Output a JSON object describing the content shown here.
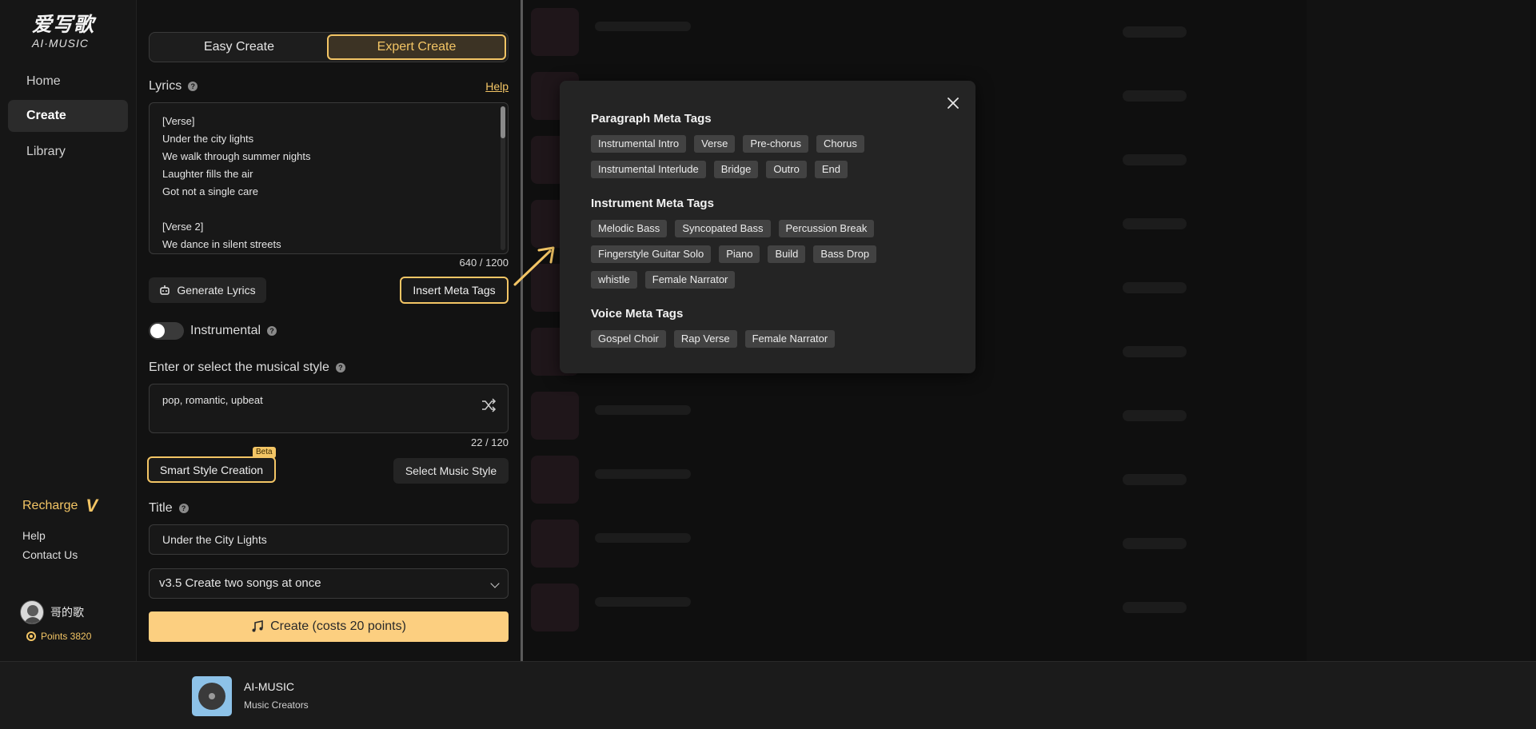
{
  "sidebar": {
    "logo_cn": "爱写歌",
    "logo_en": "AI·MUSIC",
    "items": [
      {
        "label": "Home"
      },
      {
        "label": "Create"
      },
      {
        "label": "Library"
      }
    ],
    "recharge": "Recharge",
    "recharge_badge": "V",
    "help": "Help",
    "contact": "Contact Us",
    "username": "哥的歌",
    "points": "Points 3820"
  },
  "create": {
    "modes": [
      "Easy Create",
      "Expert Create"
    ],
    "lyrics_label": "Lyrics",
    "help_link": "Help",
    "lyrics_lines": [
      "[Verse]",
      "Under the city lights",
      "We walk through summer nights",
      "Laughter fills the air",
      "Got not a single care",
      "",
      "[Verse 2]",
      "We dance in silent streets"
    ],
    "lyrics_counter": "640 / 1200",
    "generate_lyrics": "Generate Lyrics",
    "insert_meta_tags": "Insert Meta Tags",
    "instrumental_label": "Instrumental",
    "style_label": "Enter or select the musical style",
    "style_value": "pop, romantic, upbeat",
    "style_counter": "22 / 120",
    "smart_style": "Smart Style Creation",
    "beta": "Beta",
    "select_style": "Select Music Style",
    "title_label": "Title",
    "title_value": "Under the City Lights",
    "version_select": "v3.5 Create two songs at once",
    "create_button": "Create (costs 20 points)"
  },
  "meta_popup": {
    "paragraph_title": "Paragraph Meta Tags",
    "paragraph_rows": [
      [
        "Instrumental Intro",
        "Verse",
        "Pre-chorus",
        "Chorus"
      ],
      [
        "Instrumental Interlude",
        "Bridge",
        "Outro",
        "End"
      ]
    ],
    "instrument_title": "Instrument Meta Tags",
    "instrument_rows": [
      [
        "Melodic Bass",
        "Syncopated Bass",
        "Percussion Break"
      ],
      [
        "Fingerstyle Guitar Solo",
        "Piano",
        "Build",
        "Bass Drop"
      ],
      [
        "whistle",
        "Female Narrator"
      ]
    ],
    "voice_title": "Voice Meta Tags",
    "voice_rows": [
      [
        "Gospel Choir",
        "Rap Verse",
        "Female Narrator"
      ]
    ]
  },
  "player": {
    "title": "AI-MUSIC",
    "subtitle": "Music Creators"
  },
  "colors": {
    "accent": "#f3c565",
    "create_button": "#fccf80",
    "panel_bg": "#121212",
    "popup_bg": "#242424",
    "tag_bg": "#424242"
  }
}
